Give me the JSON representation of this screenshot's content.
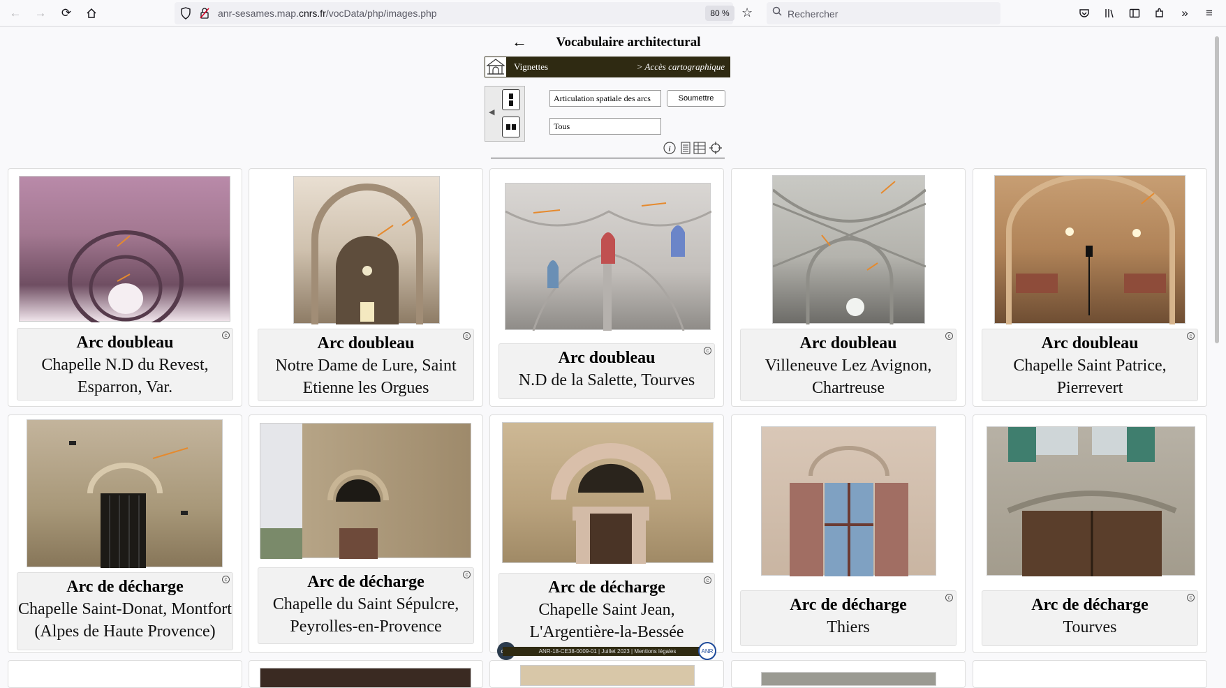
{
  "browser": {
    "url_prefix": "anr-sesames.map.",
    "url_domain": "cnrs.fr",
    "url_suffix": "/vocData/php/images.php",
    "zoom": "80 %",
    "search_placeholder": "Rechercher"
  },
  "page": {
    "title": "Vocabulaire architectural",
    "banner_left": "Vignettes",
    "banner_right": "> Accès cartographique",
    "field_category": "Articulation spatiale des arcs",
    "field_filter": "Tous",
    "submit_label": "Soumettre",
    "footer_text": "ANR-18-CE38-0009-01 | Juillet 2023 | Mentions légales",
    "footer_logo_left": "cnrs",
    "footer_logo_right": "ANR"
  },
  "cards": [
    {
      "title": "Arc doubleau",
      "subtitle": "Chapelle N.D du Revest, Esparron, Var."
    },
    {
      "title": "Arc doubleau",
      "subtitle": "Notre Dame de Lure,  Saint Etienne les Orgues"
    },
    {
      "title": "Arc doubleau",
      "subtitle": "N.D de la Salette, Tourves"
    },
    {
      "title": "Arc doubleau",
      "subtitle": "Villeneuve Lez Avignon, Chartreuse"
    },
    {
      "title": "Arc doubleau",
      "subtitle": "Chapelle Saint Patrice, Pierrevert"
    },
    {
      "title": "Arc de décharge",
      "subtitle": "Chapelle Saint-Donat, Montfort (Alpes de Haute Provence)"
    },
    {
      "title": "Arc de décharge",
      "subtitle": "Chapelle du Saint Sépulcre, Peyrolles-en-Provence"
    },
    {
      "title": "Arc de décharge",
      "subtitle": "Chapelle Saint Jean, L'Argentière-la-Bessée"
    },
    {
      "title": "Arc de décharge",
      "subtitle": "Thiers"
    },
    {
      "title": "Arc de décharge",
      "subtitle": "Tourves"
    }
  ],
  "colors": {
    "banner": "#2f2a12",
    "accent_arrow": "#e58a2e"
  }
}
